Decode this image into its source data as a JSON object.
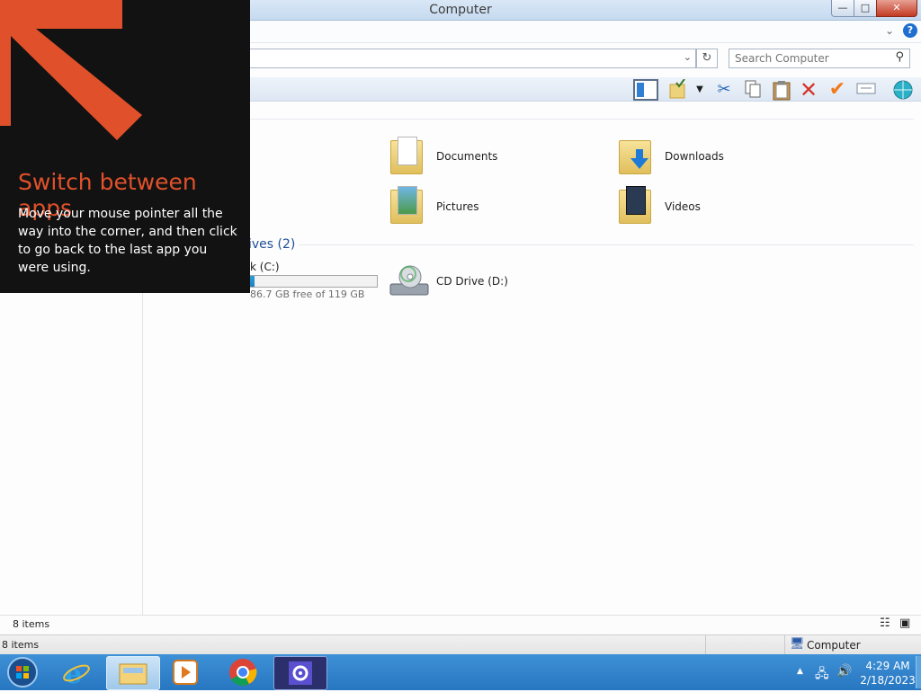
{
  "window": {
    "title": "Computer",
    "controls": {
      "minimize": "—",
      "maximize": "□",
      "close": "✕"
    },
    "help_label": "?"
  },
  "search": {
    "placeholder": "Search Computer"
  },
  "content": {
    "folders": [
      {
        "label": "Documents",
        "icon": "documents-folder-icon"
      },
      {
        "label": "Downloads",
        "icon": "downloads-folder-icon"
      },
      {
        "label": "Pictures",
        "icon": "pictures-folder-icon"
      },
      {
        "label": "Videos",
        "icon": "videos-folder-icon"
      }
    ],
    "devices_group_label": "ives (2)",
    "drives": [
      {
        "label": "k (C:)",
        "free_text": "86.7 GB free of 119 GB",
        "used_fraction": 0.27,
        "icon": "hard-drive-icon"
      },
      {
        "label": "CD Drive (D:)",
        "icon": "cd-drive-icon"
      }
    ]
  },
  "status": {
    "items_top": "8 items",
    "items_bottom": "8 items",
    "location": "Computer"
  },
  "taskbar": {
    "time": "4:29 AM",
    "date": "2/18/2023",
    "apps": [
      "start-orb-icon",
      "internet-explorer-icon",
      "file-explorer-icon",
      "media-player-icon",
      "chrome-icon",
      "settings-gear-icon"
    ]
  },
  "overlay": {
    "heading": "Switch between apps",
    "body": "Move your mouse pointer all the way into the corner, and then click to go back to the last app you were using."
  },
  "colors": {
    "accent": "#e0512b",
    "taskbar": "#2d7fc8",
    "overlay_bg": "#121212"
  }
}
